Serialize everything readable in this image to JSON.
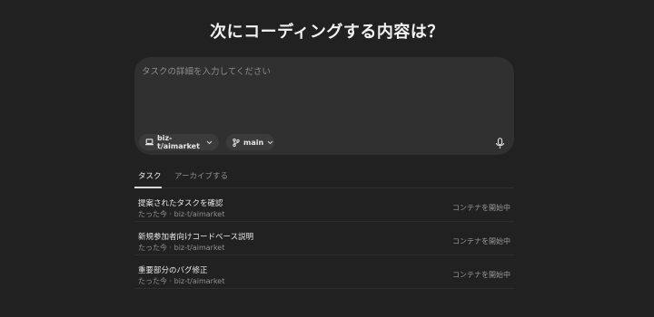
{
  "heading": "次にコーディングする内容は？",
  "composer": {
    "placeholder": "タスクの詳細を入力してください",
    "value": "",
    "repo_chip": {
      "label": "biz-t/aimarket",
      "icon": "laptop-icon"
    },
    "branch_chip": {
      "label": "main",
      "icon": "git-branch-icon"
    },
    "mic_icon": "microphone-icon"
  },
  "tabs": [
    {
      "label": "タスク",
      "active": true
    },
    {
      "label": "アーカイブする",
      "active": false
    }
  ],
  "tasks": [
    {
      "title": "提案されたタスクを確認",
      "meta": "たった今 · biz-t/aimarket",
      "status": "コンテナを開始中"
    },
    {
      "title": "新規参加者向けコードベース説明",
      "meta": "たった今 · biz-t/aimarket",
      "status": "コンテナを開始中"
    },
    {
      "title": "重要部分のバグ修正",
      "meta": "たった今 · biz-t/aimarket",
      "status": "コンテナを開始中"
    }
  ],
  "colors": {
    "background": "#212121",
    "composer": "#303030",
    "chip": "#3b3b3b"
  }
}
